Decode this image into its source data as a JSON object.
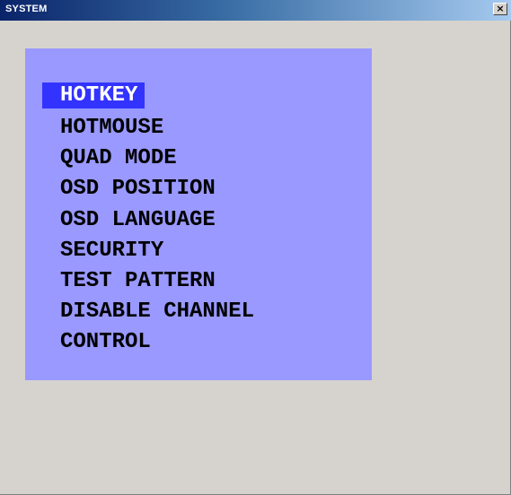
{
  "window": {
    "title": "SYSTEM",
    "close_label": "×"
  },
  "menu": {
    "selected_index": 0,
    "items": [
      "HOTKEY",
      "HOTMOUSE",
      "QUAD MODE",
      "OSD POSITION",
      "OSD LANGUAGE",
      "SECURITY",
      "TEST PATTERN",
      "DISABLE CHANNEL",
      "CONTROL"
    ],
    "colors": {
      "panel_background": "#9999ff",
      "selected_background": "#3333ff",
      "selected_text": "#ffffff",
      "text": "#000000"
    }
  }
}
